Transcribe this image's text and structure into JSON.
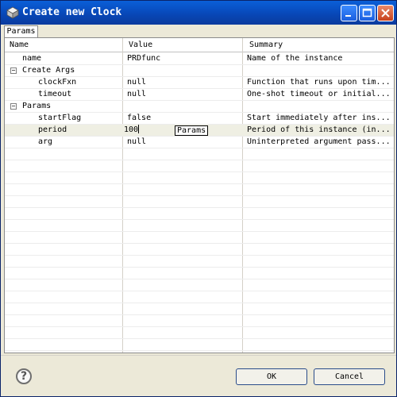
{
  "window": {
    "title": "Create new Clock"
  },
  "tab": {
    "label": "Params"
  },
  "columns": {
    "name": "Name",
    "value": "Value",
    "summary": "Summary"
  },
  "rows": [
    {
      "name": "name",
      "value": "PRDfunc",
      "summary": "Name of the instance"
    },
    {
      "name": "Create Args",
      "value": "",
      "summary": ""
    },
    {
      "name": "clockFxn",
      "value": "null",
      "summary": "Function that runs upon tim..."
    },
    {
      "name": "timeout",
      "value": "null",
      "summary": "One-shot timeout or initial..."
    },
    {
      "name": "Params",
      "value": "",
      "summary": ""
    },
    {
      "name": "startFlag",
      "value": "false",
      "summary": "Start immediately after ins..."
    },
    {
      "name": "period",
      "value": "100",
      "summary": "Period of this instance (in..."
    },
    {
      "name": "arg",
      "value": "null",
      "summary": "Uninterpreted argument pass..."
    }
  ],
  "tooltip": {
    "text": "Params"
  },
  "buttons": {
    "ok": "OK",
    "cancel": "Cancel",
    "help": "?"
  },
  "colors": {
    "titlebar": "#0a46b5",
    "selected_row": "#efefe3"
  }
}
